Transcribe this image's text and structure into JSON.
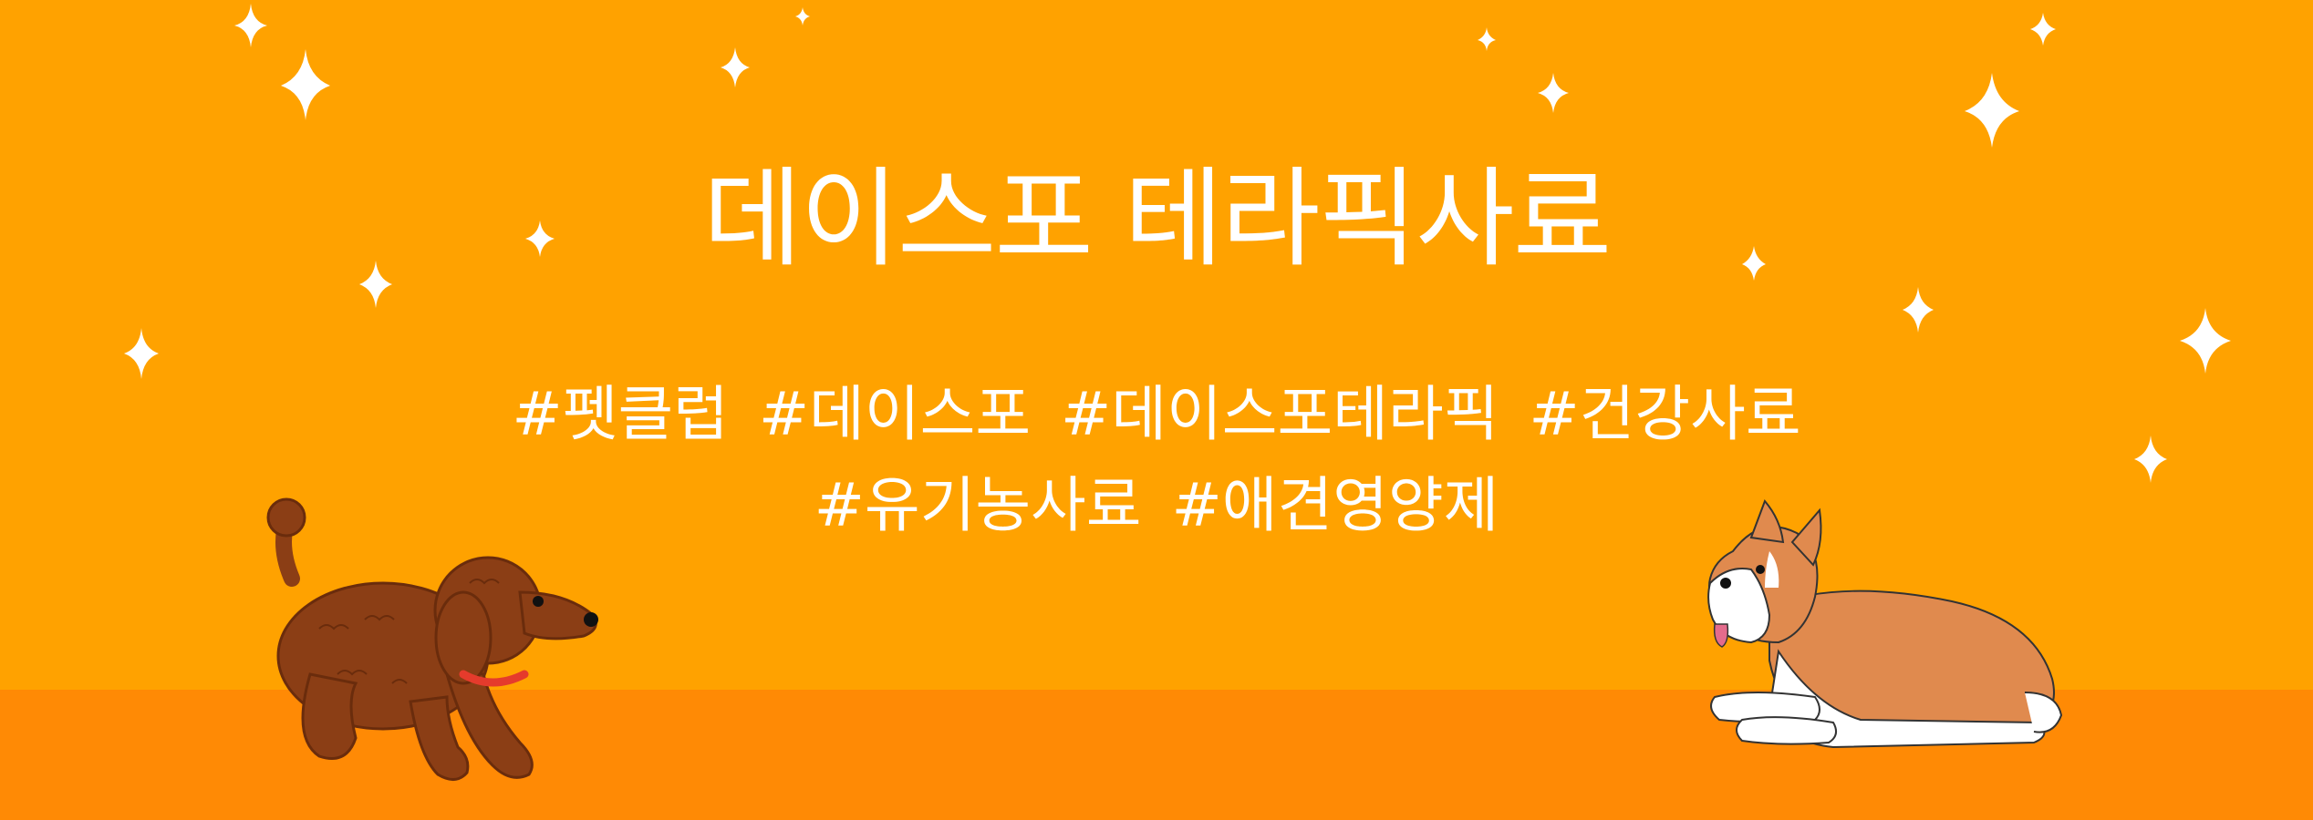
{
  "banner": {
    "title": "데이스포 테라픽사료",
    "tag_lines": [
      [
        "#펫클럽",
        "#데이스포",
        "#데이스포테라픽",
        "#건강사료"
      ],
      [
        "#유기농사료",
        "#애견영양제"
      ]
    ]
  },
  "colors": {
    "sky": "#FFA200",
    "floor": "#FF8A05",
    "text": "#FFFFFF",
    "poodle": "#8B3E15",
    "collar": "#E53B2C",
    "corgi_orange": "#E08A4E",
    "corgi_white": "#FFFFFF"
  },
  "illustrations": [
    "sparkle-icon",
    "poodle-illustration",
    "corgi-illustration"
  ]
}
